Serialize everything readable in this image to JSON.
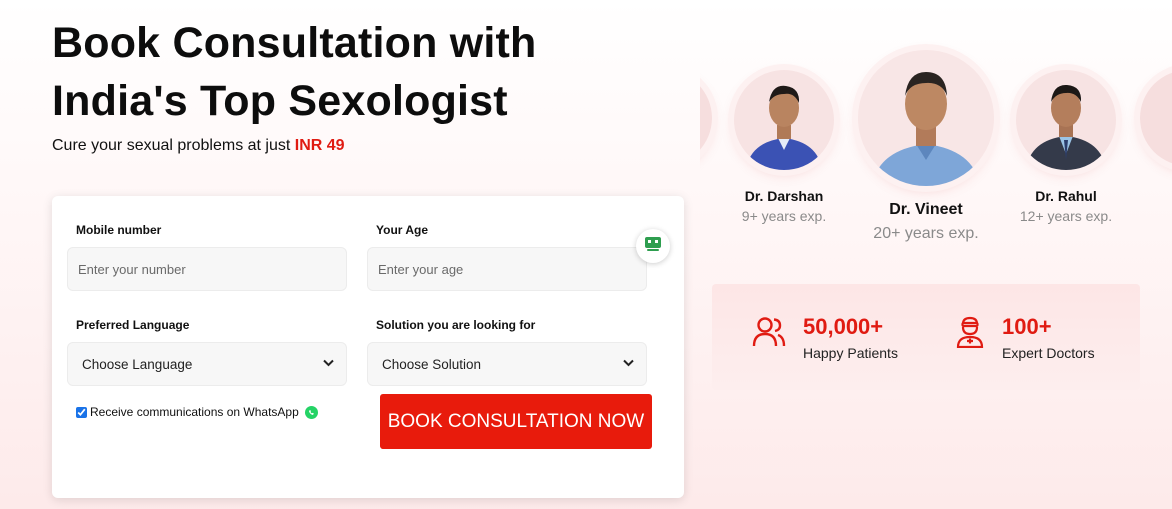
{
  "hero": {
    "title_line1": "Book Consultation with",
    "title_line2": "India's Top Sexologist",
    "subtitle_prefix": "Cure your sexual problems at just ",
    "subtitle_price": "INR 49"
  },
  "form": {
    "mobile_label": "Mobile number",
    "mobile_placeholder": "Enter your number",
    "age_label": "Your Age",
    "age_placeholder": "Enter your age",
    "language_label": "Preferred Language",
    "language_value": "Choose Language",
    "solution_label": "Solution you are looking for",
    "solution_value": "Choose Solution",
    "whatsapp_label": "Receive communications on WhatsApp",
    "whatsapp_checked": true,
    "submit_label": "BOOK CONSULTATION NOW"
  },
  "doctors": [
    {
      "name": "Dr. Darshan",
      "experience": "9+ years exp."
    },
    {
      "name": "Dr. Vineet",
      "experience": "20+ years exp."
    },
    {
      "name": "Dr. Rahul",
      "experience": "12+ years exp."
    }
  ],
  "stats": [
    {
      "icon": "users-icon",
      "value": "50,000+",
      "label": "Happy Patients"
    },
    {
      "icon": "doctor-icon",
      "value": "100+",
      "label": "Expert Doctors"
    }
  ],
  "colors": {
    "accent": "#e01b12",
    "button": "#e81b0c",
    "whatsapp": "#25d366"
  }
}
